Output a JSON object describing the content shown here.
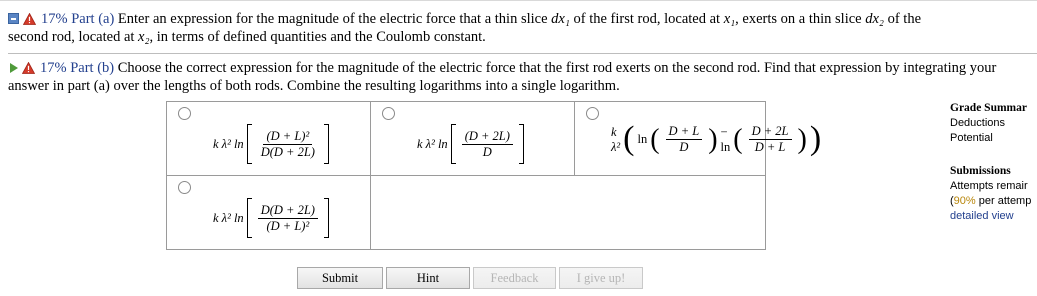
{
  "part_a": {
    "percent": "17%",
    "label": "Part (a)",
    "text_line1_pre": "Enter an expression for the magnitude of the electric force that a thin slice ",
    "text_var1": "dx₁",
    "text_mid1": " of the first rod, located at ",
    "text_var2": "x₁",
    "text_mid2": ", exerts on a thin slice ",
    "text_var3": "dx₂",
    "text_mid3": " of the",
    "text_line2_pre": "second rod, located at ",
    "text_var4": "x₂",
    "text_line2_post": ", in terms of defined quantities and the Coulomb constant."
  },
  "part_b": {
    "percent": "17%",
    "label": "Part (b)",
    "text": "Choose the correct expression for the magnitude of the electric force that the first rod exerts on the second rod. Find that expression by integrating your answer in part (a) over the lengths of both rods. Combine the resulting logarithms into a single logarithm."
  },
  "choices": {
    "c1": {
      "prefix": "k λ² ln",
      "num": "(D + L)²",
      "den": "D(D + 2L)"
    },
    "c2": {
      "prefix": "k λ² ln",
      "num": "(D + 2L)",
      "den": "D"
    },
    "c3": {
      "prefix": "k λ²",
      "ln1": "ln",
      "num1": "D + L",
      "den1": "D",
      "minus": "− ln",
      "num2": "D + 2L",
      "den2": "D + L"
    },
    "c4": {
      "prefix": "k λ² ln",
      "num": "D(D + 2L)",
      "den": "(D + L)²"
    }
  },
  "sidebar": {
    "grade_summary": "Grade Summar",
    "deductions": "Deductions",
    "potential": "Potential",
    "submissions": "Submissions",
    "attempts": "Attempts remair",
    "per_attempt_pct": "90%",
    "per_attempt_text": " per attemp",
    "detailed_view": "detailed view"
  },
  "buttons": {
    "submit": "Submit",
    "hint": "Hint",
    "feedback": "Feedback",
    "give_up": "I give up!"
  }
}
